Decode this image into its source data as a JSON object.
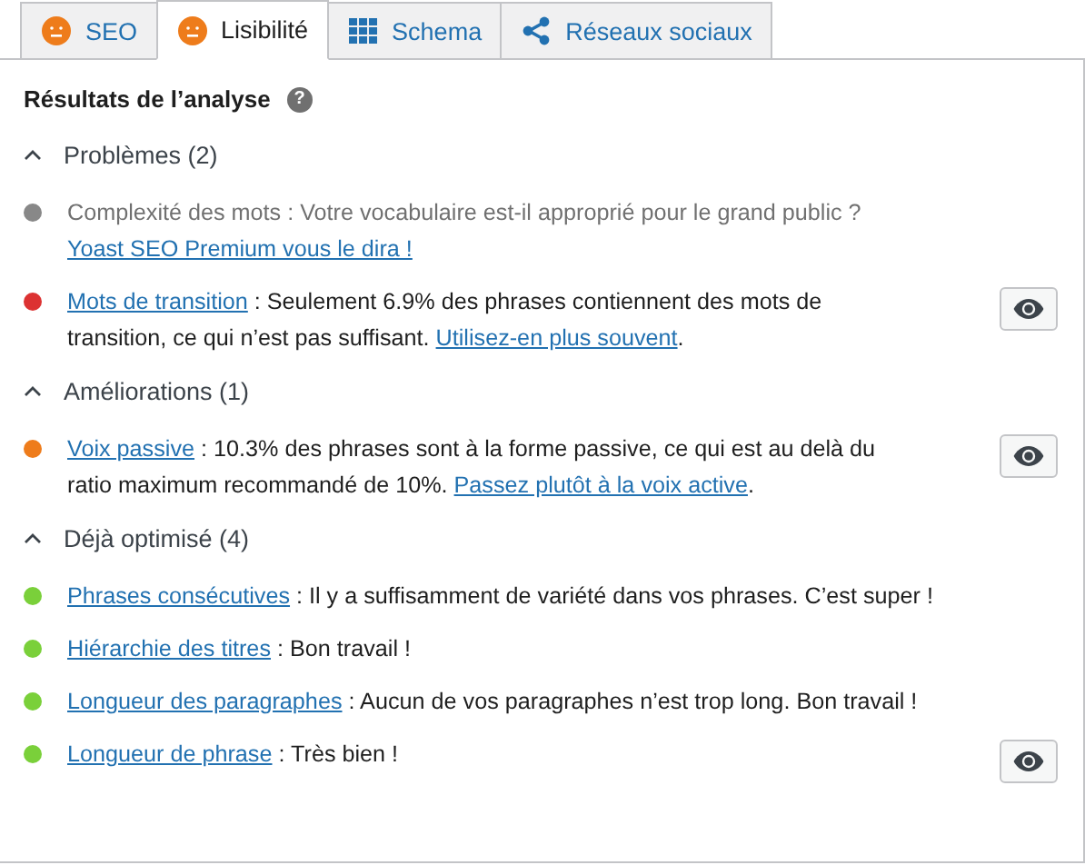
{
  "tabs": [
    {
      "label": "SEO",
      "selected": false,
      "kind": "score",
      "color": "#ee7c1b"
    },
    {
      "label": "Lisibilité",
      "selected": true,
      "kind": "score",
      "color": "#ee7c1b"
    },
    {
      "label": "Schema",
      "selected": false,
      "kind": "schema"
    },
    {
      "label": "Réseaux sociaux",
      "selected": false,
      "kind": "social"
    }
  ],
  "heading": "Résultats de l’analyse",
  "help_icon": "?",
  "groups": [
    {
      "title": "Problèmes (2)",
      "expanded": true,
      "items": [
        {
          "color": "#888888",
          "muted": true,
          "eye_button": false,
          "parts": [
            {
              "text": "Complexité des mots : Votre vocabulaire est-il approprié pour le grand public ? ",
              "link": false
            },
            {
              "text": "Yoast SEO Premium vous le dira !",
              "link": true
            }
          ]
        },
        {
          "color": "#dc3232",
          "muted": false,
          "eye_button": true,
          "parts": [
            {
              "text": "Mots de transition",
              "link": true
            },
            {
              "text": " : Seulement 6.9% des phrases contiennent des mots de transition, ce qui n’est pas suffisant. ",
              "link": false
            },
            {
              "text": "Utilisez-en plus souvent",
              "link": true
            },
            {
              "text": ".",
              "link": false
            }
          ]
        }
      ]
    },
    {
      "title": "Améliorations (1)",
      "expanded": true,
      "items": [
        {
          "color": "#ee7c1b",
          "muted": false,
          "eye_button": true,
          "parts": [
            {
              "text": "Voix passive",
              "link": true
            },
            {
              "text": " : 10.3% des phrases sont à la forme passive, ce qui est au delà du ratio maximum recommandé de 10%. ",
              "link": false
            },
            {
              "text": "Passez plutôt à la voix active",
              "link": true
            },
            {
              "text": ".",
              "link": false
            }
          ]
        }
      ]
    },
    {
      "title": "Déjà optimisé (4)",
      "expanded": true,
      "items": [
        {
          "color": "#7ad03a",
          "muted": false,
          "eye_button": false,
          "parts": [
            {
              "text": "Phrases consécutives",
              "link": true
            },
            {
              "text": " : Il y a suffisamment de variété dans vos phrases. C’est super !",
              "link": false
            }
          ]
        },
        {
          "color": "#7ad03a",
          "muted": false,
          "eye_button": false,
          "parts": [
            {
              "text": "Hiérarchie des titres",
              "link": true
            },
            {
              "text": " : Bon travail !",
              "link": false
            }
          ]
        },
        {
          "color": "#7ad03a",
          "muted": false,
          "eye_button": false,
          "parts": [
            {
              "text": "Longueur des paragraphes",
              "link": true
            },
            {
              "text": " : Aucun de vos paragraphes n’est trop long. Bon travail !",
              "link": false
            }
          ]
        },
        {
          "color": "#7ad03a",
          "muted": false,
          "eye_button": true,
          "parts": [
            {
              "text": "Longueur de phrase",
              "link": true
            },
            {
              "text": " : Très bien !",
              "link": false
            }
          ]
        }
      ]
    }
  ]
}
